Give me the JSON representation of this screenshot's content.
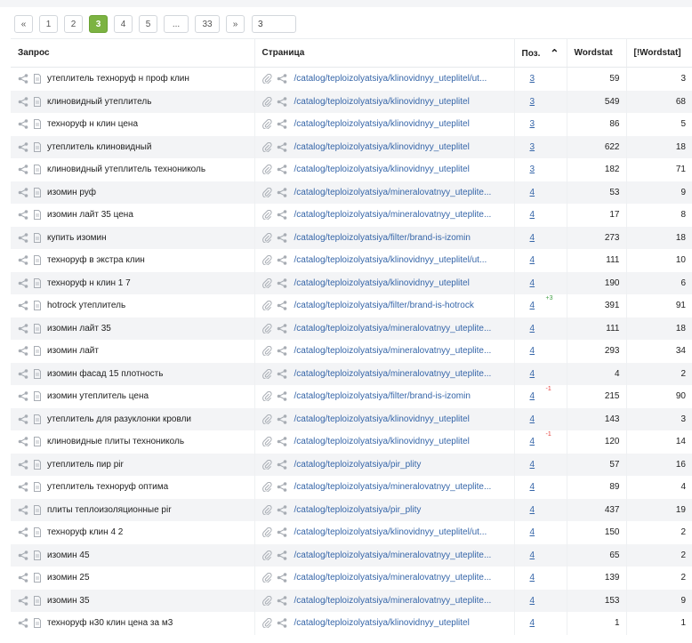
{
  "pagination": {
    "prev": "«",
    "next": "»",
    "pages": [
      "1",
      "2",
      "3",
      "4",
      "5",
      "...",
      "33"
    ],
    "active": "3",
    "input_value": "3"
  },
  "table": {
    "headers": {
      "query": "Запрос",
      "page": "Страница",
      "pos": "Поз.",
      "wordstat": "Wordstat",
      "exact": "[!Wordstat]"
    },
    "sort_icon": "chevron-up-icon",
    "rows": [
      {
        "query": "утеплитель технoруф н проф клин",
        "url": "/catalog/teploizolyatsiya/klinovidnyy_uteplitel/ut...",
        "pos": "3",
        "delta": "",
        "ws": "59",
        "exact": "3"
      },
      {
        "query": "клиновидный утеплитель",
        "url": "/catalog/teploizolyatsiya/klinovidnyy_uteplitel",
        "pos": "3",
        "delta": "",
        "ws": "549",
        "exact": "68"
      },
      {
        "query": "технoруф н клин цена",
        "url": "/catalog/teploizolyatsiya/klinovidnyy_uteplitel",
        "pos": "3",
        "delta": "",
        "ws": "86",
        "exact": "5"
      },
      {
        "query": "утеплитель клиновидный",
        "url": "/catalog/teploizolyatsiya/klinovidnyy_uteplitel",
        "pos": "3",
        "delta": "",
        "ws": "622",
        "exact": "18"
      },
      {
        "query": "клиновидный утеплитель технониколь",
        "url": "/catalog/teploizolyatsiya/klinovidnyy_uteplitel",
        "pos": "3",
        "delta": "",
        "ws": "182",
        "exact": "71"
      },
      {
        "query": "изомин руф",
        "url": "/catalog/teploizolyatsiya/mineralovatnyy_uteplite...",
        "pos": "4",
        "delta": "",
        "ws": "53",
        "exact": "9"
      },
      {
        "query": "изомин лайт 35 цена",
        "url": "/catalog/teploizolyatsiya/mineralovatnyy_uteplite...",
        "pos": "4",
        "delta": "",
        "ws": "17",
        "exact": "8"
      },
      {
        "query": "купить изомин",
        "url": "/catalog/teploizolyatsiya/filter/brand-is-izomin",
        "pos": "4",
        "delta": "",
        "ws": "273",
        "exact": "18"
      },
      {
        "query": "технoруф в экстра клин",
        "url": "/catalog/teploizolyatsiya/klinovidnyy_uteplitel/ut...",
        "pos": "4",
        "delta": "",
        "ws": "111",
        "exact": "10"
      },
      {
        "query": "технoруф н клин 1 7",
        "url": "/catalog/teploizolyatsiya/klinovidnyy_uteplitel",
        "pos": "4",
        "delta": "",
        "ws": "190",
        "exact": "6"
      },
      {
        "query": "hotrock утеплитель",
        "url": "/catalog/teploizolyatsiya/filter/brand-is-hotrock",
        "pos": "4",
        "delta": "+3",
        "ws": "391",
        "exact": "91"
      },
      {
        "query": "изомин лайт 35",
        "url": "/catalog/teploizolyatsiya/mineralovatnyy_uteplite...",
        "pos": "4",
        "delta": "",
        "ws": "111",
        "exact": "18"
      },
      {
        "query": "изомин лайт",
        "url": "/catalog/teploizolyatsiya/mineralovatnyy_uteplite...",
        "pos": "4",
        "delta": "",
        "ws": "293",
        "exact": "34"
      },
      {
        "query": "изомин фасад 15 плотность",
        "url": "/catalog/teploizolyatsiya/mineralovatnyy_uteplite...",
        "pos": "4",
        "delta": "",
        "ws": "4",
        "exact": "2"
      },
      {
        "query": "изомин утеплитель цена",
        "url": "/catalog/teploizolyatsiya/filter/brand-is-izomin",
        "pos": "4",
        "delta": "-1",
        "ws": "215",
        "exact": "90"
      },
      {
        "query": "утеплитель для разуклонки кровли",
        "url": "/catalog/teploizolyatsiya/klinovidnyy_uteplitel",
        "pos": "4",
        "delta": "",
        "ws": "143",
        "exact": "3"
      },
      {
        "query": "клиновидные плиты технониколь",
        "url": "/catalog/teploizolyatsiya/klinovidnyy_uteplitel",
        "pos": "4",
        "delta": "-1",
        "ws": "120",
        "exact": "14"
      },
      {
        "query": "утеплитель пир pir",
        "url": "/catalog/teploizolyatsiya/pir_plity",
        "pos": "4",
        "delta": "",
        "ws": "57",
        "exact": "16"
      },
      {
        "query": "утеплитель технoруф оптима",
        "url": "/catalog/teploizolyatsiya/mineralovatnyy_uteplite...",
        "pos": "4",
        "delta": "",
        "ws": "89",
        "exact": "4"
      },
      {
        "query": "плиты теплоизоляционные pir",
        "url": "/catalog/teploizolyatsiya/pir_plity",
        "pos": "4",
        "delta": "",
        "ws": "437",
        "exact": "19"
      },
      {
        "query": "технoруф клин 4 2",
        "url": "/catalog/teploizolyatsiya/klinovidnyy_uteplitel/ut...",
        "pos": "4",
        "delta": "",
        "ws": "150",
        "exact": "2"
      },
      {
        "query": "изомин 45",
        "url": "/catalog/teploizolyatsiya/mineralovatnyy_uteplite...",
        "pos": "4",
        "delta": "",
        "ws": "65",
        "exact": "2"
      },
      {
        "query": "изомин 25",
        "url": "/catalog/teploizolyatsiya/mineralovatnyy_uteplite...",
        "pos": "4",
        "delta": "",
        "ws": "139",
        "exact": "2"
      },
      {
        "query": "изомин 35",
        "url": "/catalog/teploizolyatsiya/mineralovatnyy_uteplite...",
        "pos": "4",
        "delta": "",
        "ws": "153",
        "exact": "9"
      },
      {
        "query": "технoруф н30 клин цена за м3",
        "url": "/catalog/teploizolyatsiya/klinovidnyy_uteplitel",
        "pos": "4",
        "delta": "",
        "ws": "1",
        "exact": "1"
      }
    ]
  },
  "colors": {
    "active_page": "#7cb342",
    "link": "#3565a8",
    "up": "#43a047",
    "down": "#e53935",
    "row_alt": "#f3f4f6"
  }
}
